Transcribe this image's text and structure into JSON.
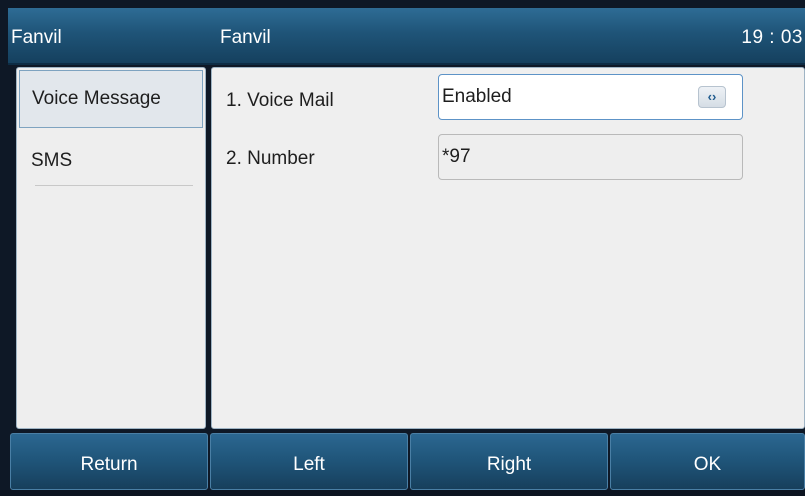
{
  "titlebar": {
    "left_title": "Fanvil",
    "center_title": "Fanvil",
    "clock": "19 : 03"
  },
  "menu": {
    "items": [
      {
        "label": "Voice Message",
        "selected": true
      },
      {
        "label": "SMS",
        "selected": false
      }
    ]
  },
  "form": {
    "rows": [
      {
        "label": "1.  Voice Mail",
        "value": "Enabled",
        "control": "select",
        "icon": "left-right-arrows-icon"
      },
      {
        "label": "2. Number",
        "value": "*97",
        "control": "text"
      }
    ]
  },
  "softkeys": {
    "return": "Return",
    "left": "Left",
    "right": "Right",
    "ok": "OK"
  },
  "colors": {
    "titlebar": "#1f5478",
    "accent_border": "#5d93c7",
    "panel_bg": "#efefef"
  }
}
